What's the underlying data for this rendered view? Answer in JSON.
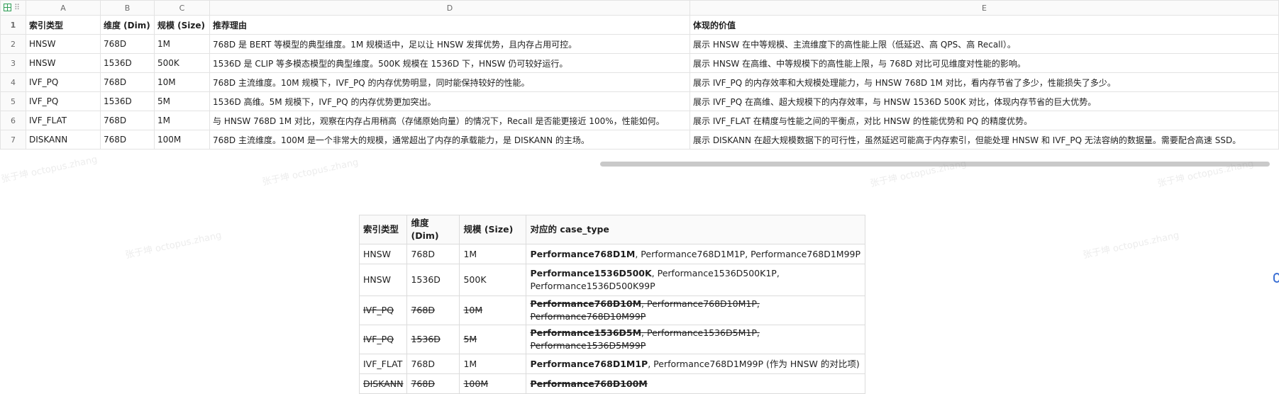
{
  "spreadsheet": {
    "columns": [
      "A",
      "B",
      "C",
      "D",
      "E"
    ],
    "rows": [
      {
        "num": "1",
        "a": "索引类型",
        "b": "维度 (Dim)",
        "c": "规模 (Size)",
        "d": "推荐理由",
        "e": "体现的价值"
      },
      {
        "num": "2",
        "a": "HNSW",
        "b": "768D",
        "c": "1M",
        "d": "768D 是 BERT 等模型的典型维度。1M 规模适中，足以让 HNSW 发挥优势，且内存占用可控。",
        "e": "展示 HNSW 在中等规模、主流维度下的高性能上限（低延迟、高 QPS、高 Recall）。"
      },
      {
        "num": "3",
        "a": "HNSW",
        "b": "1536D",
        "c": "500K",
        "d": "1536D 是 CLIP 等多模态模型的典型维度。500K 规模在 1536D 下，HNSW 仍可较好运行。",
        "e": "展示 HNSW 在高维、中等规模下的高性能上限，与 768D 对比可见维度对性能的影响。"
      },
      {
        "num": "4",
        "a": "IVF_PQ",
        "b": "768D",
        "c": "10M",
        "d": "768D 主流维度。10M 规模下，IVF_PQ 的内存优势明显，同时能保持较好的性能。",
        "e": "展示 IVF_PQ 的内存效率和大规模处理能力，与 HNSW 768D 1M 对比，看内存节省了多少，性能损失了多少。"
      },
      {
        "num": "5",
        "a": "IVF_PQ",
        "b": "1536D",
        "c": "5M",
        "d": "1536D 高维。5M 规模下，IVF_PQ 的内存优势更加突出。",
        "e": "展示 IVF_PQ 在高维、超大规模下的内存效率，与 HNSW 1536D 500K 对比，体现内存节省的巨大优势。"
      },
      {
        "num": "6",
        "a": "IVF_FLAT",
        "b": "768D",
        "c": "1M",
        "d": "与 HNSW 768D 1M 对比，观察在内存占用稍高（存储原始向量）的情况下，Recall 是否能更接近 100%，性能如何。",
        "e": "展示 IVF_FLAT 在精度与性能之间的平衡点，对比 HNSW 的性能优势和 PQ 的精度优势。"
      },
      {
        "num": "7",
        "a": "DISKANN",
        "b": "768D",
        "c": "100M",
        "d": "768D 主流维度。100M 是一个非常大的规模，通常超出了内存的承载能力，是 DISKANN 的主场。",
        "e": "展示 DISKANN 在超大规模数据下的可行性，虽然延迟可能高于内存索引，但能处理 HNSW 和 IVF_PQ 无法容纳的数据量。需要配合高速 SSD。"
      }
    ]
  },
  "case_table": {
    "headers": [
      "索引类型",
      "维度 (Dim)",
      "规模 (Size)",
      "对应的 case_type"
    ],
    "rows": [
      {
        "type": "HNSW",
        "dim": "768D",
        "size": "1M",
        "primary": "Performance768D1M",
        "rest": ", Performance768D1M1P, Performance768D1M99P",
        "strike": false
      },
      {
        "type": "HNSW",
        "dim": "1536D",
        "size": "500K",
        "primary": "Performance1536D500K",
        "rest": ", Performance1536D500K1P, Performance1536D500K99P",
        "strike": false
      },
      {
        "type": "IVF_PQ",
        "dim": "768D",
        "size": "10M",
        "primary": "Performance768D10M",
        "rest": ", Performance768D10M1P, Performance768D10M99P",
        "strike": true
      },
      {
        "type": "IVF_PQ",
        "dim": "1536D",
        "size": "5M",
        "primary": "Performance1536D5M",
        "rest": ", Performance1536D5M1P, Performance1536D5M99P",
        "strike": true
      },
      {
        "type": "IVF_FLAT",
        "dim": "768D",
        "size": "1M",
        "primary": "Performance768D1M1P",
        "rest": ", Performance768D1M99P (作为 HNSW 的对比项)",
        "strike": false
      },
      {
        "type": "DISKANN",
        "dim": "768D",
        "size": "100M",
        "primary": "Performance768D100M",
        "rest": "",
        "strike": true
      }
    ]
  },
  "watermark_text": "张于坤 octopus.zhang"
}
